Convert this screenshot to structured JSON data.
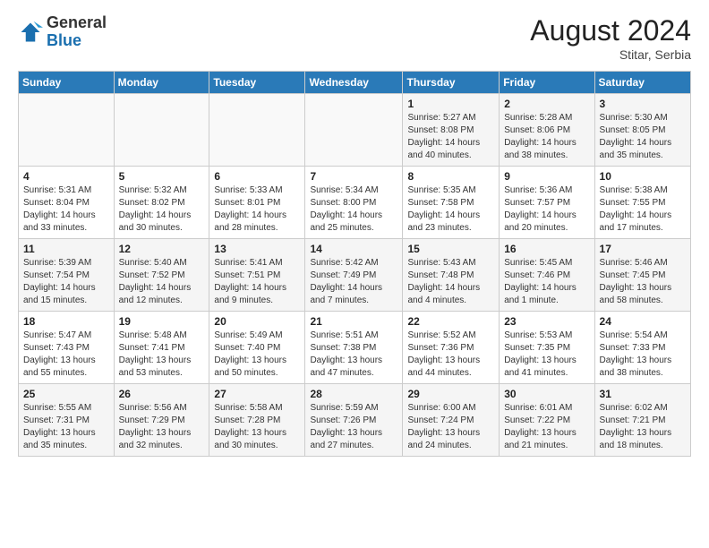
{
  "header": {
    "logo": {
      "general": "General",
      "blue": "Blue"
    },
    "title": "August 2024",
    "location": "Stitar, Serbia"
  },
  "weekdays": [
    "Sunday",
    "Monday",
    "Tuesday",
    "Wednesday",
    "Thursday",
    "Friday",
    "Saturday"
  ],
  "weeks": [
    [
      {
        "day": "",
        "info": ""
      },
      {
        "day": "",
        "info": ""
      },
      {
        "day": "",
        "info": ""
      },
      {
        "day": "",
        "info": ""
      },
      {
        "day": "1",
        "info": "Sunrise: 5:27 AM\nSunset: 8:08 PM\nDaylight: 14 hours\nand 40 minutes."
      },
      {
        "day": "2",
        "info": "Sunrise: 5:28 AM\nSunset: 8:06 PM\nDaylight: 14 hours\nand 38 minutes."
      },
      {
        "day": "3",
        "info": "Sunrise: 5:30 AM\nSunset: 8:05 PM\nDaylight: 14 hours\nand 35 minutes."
      }
    ],
    [
      {
        "day": "4",
        "info": "Sunrise: 5:31 AM\nSunset: 8:04 PM\nDaylight: 14 hours\nand 33 minutes."
      },
      {
        "day": "5",
        "info": "Sunrise: 5:32 AM\nSunset: 8:02 PM\nDaylight: 14 hours\nand 30 minutes."
      },
      {
        "day": "6",
        "info": "Sunrise: 5:33 AM\nSunset: 8:01 PM\nDaylight: 14 hours\nand 28 minutes."
      },
      {
        "day": "7",
        "info": "Sunrise: 5:34 AM\nSunset: 8:00 PM\nDaylight: 14 hours\nand 25 minutes."
      },
      {
        "day": "8",
        "info": "Sunrise: 5:35 AM\nSunset: 7:58 PM\nDaylight: 14 hours\nand 23 minutes."
      },
      {
        "day": "9",
        "info": "Sunrise: 5:36 AM\nSunset: 7:57 PM\nDaylight: 14 hours\nand 20 minutes."
      },
      {
        "day": "10",
        "info": "Sunrise: 5:38 AM\nSunset: 7:55 PM\nDaylight: 14 hours\nand 17 minutes."
      }
    ],
    [
      {
        "day": "11",
        "info": "Sunrise: 5:39 AM\nSunset: 7:54 PM\nDaylight: 14 hours\nand 15 minutes."
      },
      {
        "day": "12",
        "info": "Sunrise: 5:40 AM\nSunset: 7:52 PM\nDaylight: 14 hours\nand 12 minutes."
      },
      {
        "day": "13",
        "info": "Sunrise: 5:41 AM\nSunset: 7:51 PM\nDaylight: 14 hours\nand 9 minutes."
      },
      {
        "day": "14",
        "info": "Sunrise: 5:42 AM\nSunset: 7:49 PM\nDaylight: 14 hours\nand 7 minutes."
      },
      {
        "day": "15",
        "info": "Sunrise: 5:43 AM\nSunset: 7:48 PM\nDaylight: 14 hours\nand 4 minutes."
      },
      {
        "day": "16",
        "info": "Sunrise: 5:45 AM\nSunset: 7:46 PM\nDaylight: 14 hours\nand 1 minute."
      },
      {
        "day": "17",
        "info": "Sunrise: 5:46 AM\nSunset: 7:45 PM\nDaylight: 13 hours\nand 58 minutes."
      }
    ],
    [
      {
        "day": "18",
        "info": "Sunrise: 5:47 AM\nSunset: 7:43 PM\nDaylight: 13 hours\nand 55 minutes."
      },
      {
        "day": "19",
        "info": "Sunrise: 5:48 AM\nSunset: 7:41 PM\nDaylight: 13 hours\nand 53 minutes."
      },
      {
        "day": "20",
        "info": "Sunrise: 5:49 AM\nSunset: 7:40 PM\nDaylight: 13 hours\nand 50 minutes."
      },
      {
        "day": "21",
        "info": "Sunrise: 5:51 AM\nSunset: 7:38 PM\nDaylight: 13 hours\nand 47 minutes."
      },
      {
        "day": "22",
        "info": "Sunrise: 5:52 AM\nSunset: 7:36 PM\nDaylight: 13 hours\nand 44 minutes."
      },
      {
        "day": "23",
        "info": "Sunrise: 5:53 AM\nSunset: 7:35 PM\nDaylight: 13 hours\nand 41 minutes."
      },
      {
        "day": "24",
        "info": "Sunrise: 5:54 AM\nSunset: 7:33 PM\nDaylight: 13 hours\nand 38 minutes."
      }
    ],
    [
      {
        "day": "25",
        "info": "Sunrise: 5:55 AM\nSunset: 7:31 PM\nDaylight: 13 hours\nand 35 minutes."
      },
      {
        "day": "26",
        "info": "Sunrise: 5:56 AM\nSunset: 7:29 PM\nDaylight: 13 hours\nand 32 minutes."
      },
      {
        "day": "27",
        "info": "Sunrise: 5:58 AM\nSunset: 7:28 PM\nDaylight: 13 hours\nand 30 minutes."
      },
      {
        "day": "28",
        "info": "Sunrise: 5:59 AM\nSunset: 7:26 PM\nDaylight: 13 hours\nand 27 minutes."
      },
      {
        "day": "29",
        "info": "Sunrise: 6:00 AM\nSunset: 7:24 PM\nDaylight: 13 hours\nand 24 minutes."
      },
      {
        "day": "30",
        "info": "Sunrise: 6:01 AM\nSunset: 7:22 PM\nDaylight: 13 hours\nand 21 minutes."
      },
      {
        "day": "31",
        "info": "Sunrise: 6:02 AM\nSunset: 7:21 PM\nDaylight: 13 hours\nand 18 minutes."
      }
    ]
  ]
}
